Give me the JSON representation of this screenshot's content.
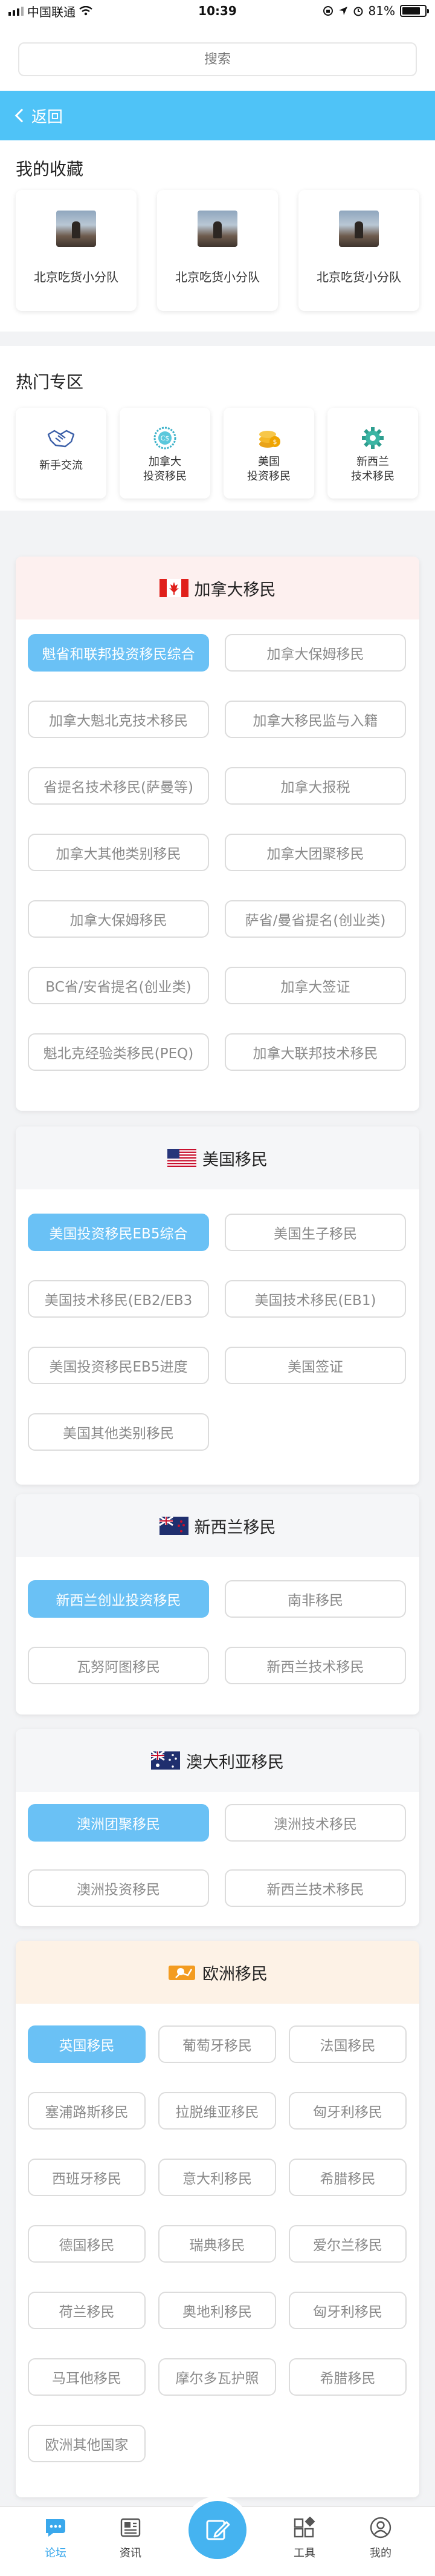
{
  "status_bar": {
    "carrier": "中国联通",
    "time": "10:39",
    "battery": "81%",
    "battery_level": 0.81
  },
  "search": {
    "placeholder": "搜索"
  },
  "nav": {
    "back_label": "返回"
  },
  "favorites": {
    "title": "我的收藏",
    "items": [
      {
        "name": "北京吃货小分队"
      },
      {
        "name": "北京吃货小分队"
      },
      {
        "name": "北京吃货小分队"
      }
    ]
  },
  "hot": {
    "title": "热门专区",
    "items": [
      {
        "label": "新手交流",
        "icon": "handshake-icon"
      },
      {
        "label": "加拿大\n投资移民",
        "icon": "canada-coin-icon"
      },
      {
        "label": "美国\n投资移民",
        "icon": "usa-coin-icon"
      },
      {
        "label": "新西兰\n技术移民",
        "icon": "gear-icon"
      }
    ]
  },
  "canada": {
    "title": "加拿大移民",
    "chips": [
      "魁省和联邦投资移民综合",
      "加拿大保姆移民",
      "加拿大魁北克技术移民",
      "加拿大移民监与入籍",
      "省提名技术移民(萨曼等)",
      "加拿大报税",
      "加拿大其他类别移民",
      "加拿大团聚移民",
      "加拿大保姆移民",
      "萨省/曼省提名(创业类)",
      "BC省/安省提名(创业类)",
      "加拿大签证",
      "魁北克经验类移民(PEQ)",
      "加拿大联邦技术移民"
    ]
  },
  "usa": {
    "title": "美国移民",
    "chips": [
      "美国投资移民EB5综合",
      "美国生子移民",
      "美国技术移民(EB2/EB3",
      "美国技术移民(EB1)",
      "美国投资移民EB5进度",
      "美国签证",
      "美国其他类别移民"
    ]
  },
  "nz": {
    "title": "新西兰移民",
    "chips": [
      "新西兰创业投资移民",
      "南非移民",
      "瓦努阿图移民",
      "新西兰技术移民"
    ]
  },
  "au": {
    "title": "澳大利亚移民",
    "chips": [
      "澳洲团聚移民",
      "澳洲技术移民",
      "澳洲投资移民",
      "新西兰技术移民"
    ]
  },
  "eu": {
    "title": "欧洲移民",
    "chips": [
      "英国移民",
      "葡萄牙移民",
      "法国移民",
      "塞浦路斯移民",
      "拉脱维亚移民",
      "匈牙利移民",
      "西班牙移民",
      "意大利移民",
      "希腊移民",
      "德国移民",
      "瑞典移民",
      "爱尔兰移民",
      "荷兰移民",
      "奥地利移民",
      "匈牙利移民",
      "马耳他移民",
      "摩尔多瓦护照",
      "希腊移民",
      "欧洲其他国家"
    ]
  },
  "tabbar": {
    "items": [
      {
        "label": "论坛",
        "icon": "forum-icon",
        "active": true
      },
      {
        "label": "资讯",
        "icon": "news-icon",
        "active": false
      },
      {
        "label": "工具",
        "icon": "tools-icon",
        "active": false
      },
      {
        "label": "我的",
        "icon": "profile-icon",
        "active": false
      }
    ]
  },
  "colors": {
    "accent": "#4fc3f7",
    "chip_selected": "#6ac1f5",
    "canada_header": "#fdf0ef",
    "eu_header": "#fdf2e6"
  }
}
